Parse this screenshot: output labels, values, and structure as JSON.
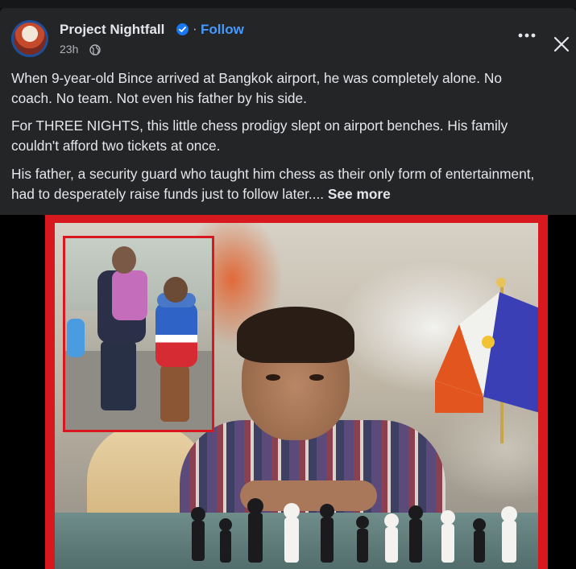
{
  "post": {
    "page_name": "Project Nightfall",
    "separator": "·",
    "follow_label": "Follow",
    "time": "23h",
    "privacy_icon": "globe-icon",
    "paragraphs": {
      "p1": {
        "line1": "When 9-year-old Bince arrived at Bangkok airport, he was completely alone. No",
        "line2": "coach. No team. Not even his father by his side."
      },
      "p2": {
        "line1": "For THREE NIGHTS, this little chess prodigy slept on airport benches. His family",
        "line2": "couldn't afford two tickets at once."
      },
      "p3": {
        "line1": "His father, a security guard who taught him chess as their only form of entertainment,",
        "line2": "had to desperately raise funds just to follow later....",
        "see_more": "See more"
      }
    }
  },
  "controls": {
    "more_icon": "more-options-icon",
    "close_icon": "close-icon"
  },
  "colors": {
    "card_bg": "#242526",
    "accent_blue": "#4599ff",
    "verified_blue": "#1877f2",
    "frame_red": "#d8181f"
  }
}
